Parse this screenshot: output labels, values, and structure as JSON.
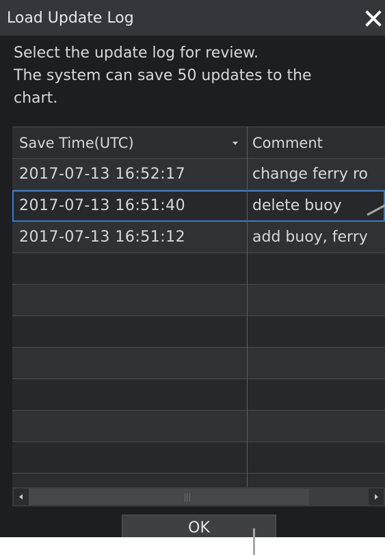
{
  "dialog": {
    "title": "Load Update Log",
    "instructions": [
      "Select the update log for review.",
      "The system can save 50 updates to the",
      "chart."
    ]
  },
  "table": {
    "columns": [
      "Save Time(UTC)",
      "Comment"
    ],
    "rows": [
      {
        "time": "2017-07-13 16:52:17",
        "comment": "change ferry ro"
      },
      {
        "time": "2017-07-13 16:51:40",
        "comment": "delete buoy"
      },
      {
        "time": "2017-07-13 16:51:12",
        "comment": "add buoy, ferry"
      }
    ],
    "selected_row": 1,
    "visible_row_slots": 10
  },
  "buttons": {
    "ok_label": "OK"
  },
  "icons": {
    "close": "close-icon",
    "sort": "sort-descending-icon",
    "scroll_left": "arrow-left-icon",
    "scroll_right": "arrow-right-icon"
  },
  "colors": {
    "selection": "#3d7bc8",
    "background": "#1c1e22",
    "titlebar": "#33363b"
  }
}
